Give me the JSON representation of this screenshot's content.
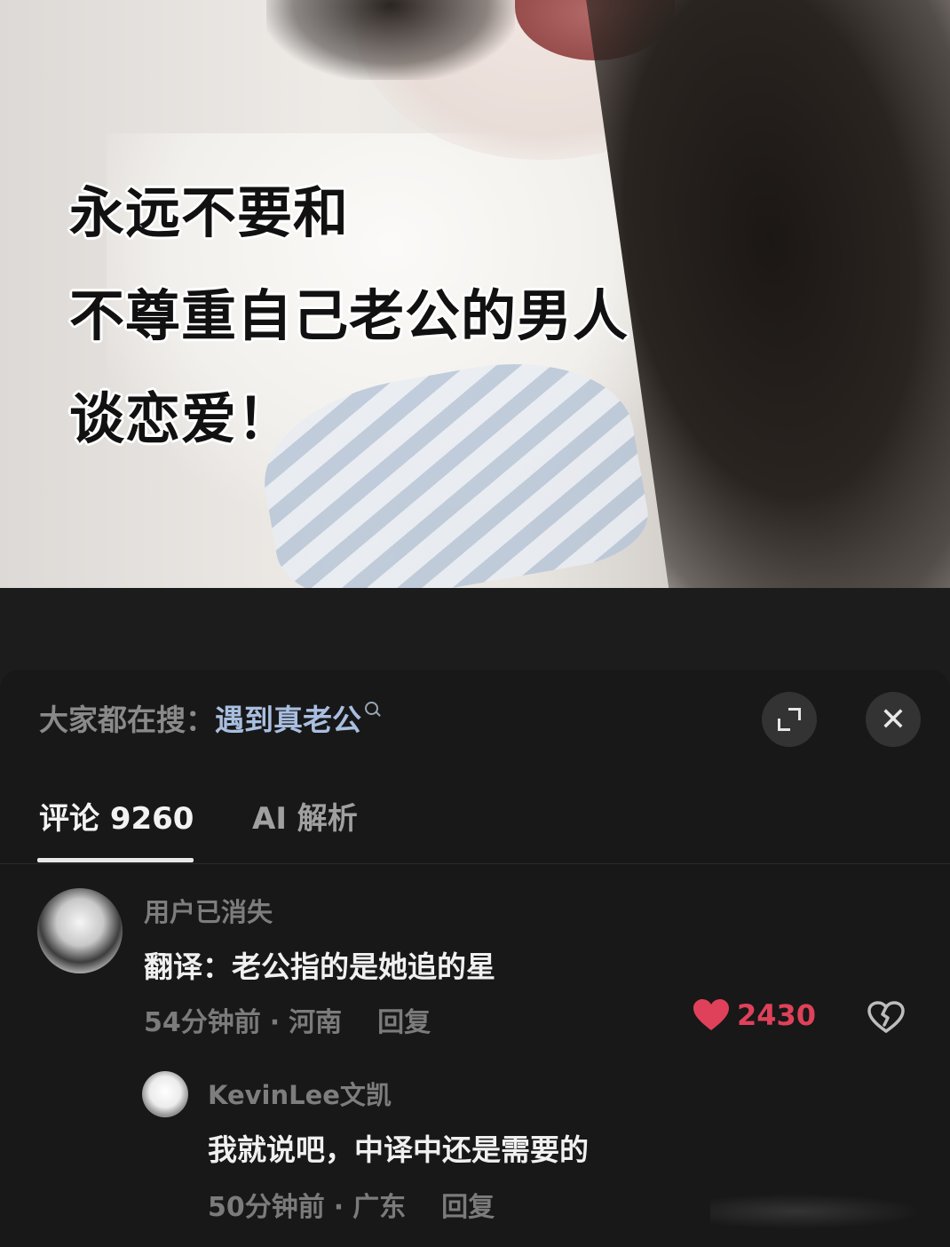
{
  "post": {
    "headline_lines": [
      "永远不要和",
      "不尊重自己老公的男人",
      "谈恋爱！"
    ]
  },
  "search": {
    "label": "大家都在搜：",
    "term": "遇到真老公"
  },
  "controls": {
    "expand_icon": "expand-icon",
    "close_icon": "close-icon",
    "close_glyph": "✕"
  },
  "tabs": [
    {
      "label": "评论 9260",
      "active": true
    },
    {
      "label": "AI 解析",
      "active": false
    }
  ],
  "comments": [
    {
      "username": "用户已消失",
      "text": "翻译：老公指的是她追的星",
      "time": "54分钟前",
      "location": "河南",
      "reply_label": "回复",
      "likes": "2430",
      "like_color": "#e0415a",
      "replies": [
        {
          "username": "KevinLee文凯",
          "text": "我就说吧，中译中还是需要的",
          "time": "50分钟前",
          "location": "广东",
          "reply_label": "回复"
        }
      ]
    }
  ],
  "meta_separator": "·"
}
